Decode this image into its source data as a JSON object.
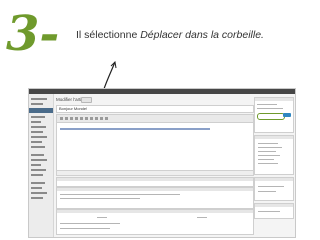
{
  "step": {
    "number": "3-"
  },
  "instruction": {
    "prefix": "Il sélectionne ",
    "emphasis": "Déplacer dans la corbeille."
  },
  "colors": {
    "accent": "#6f9a2c",
    "text": "#333333",
    "admin_dark": "#464646",
    "primary_button": "#2e86c1"
  },
  "screenshot": {
    "page_title": "Modifier l'article",
    "post_title": "Bonjour Monde!",
    "highlight": "move-to-trash-link"
  }
}
